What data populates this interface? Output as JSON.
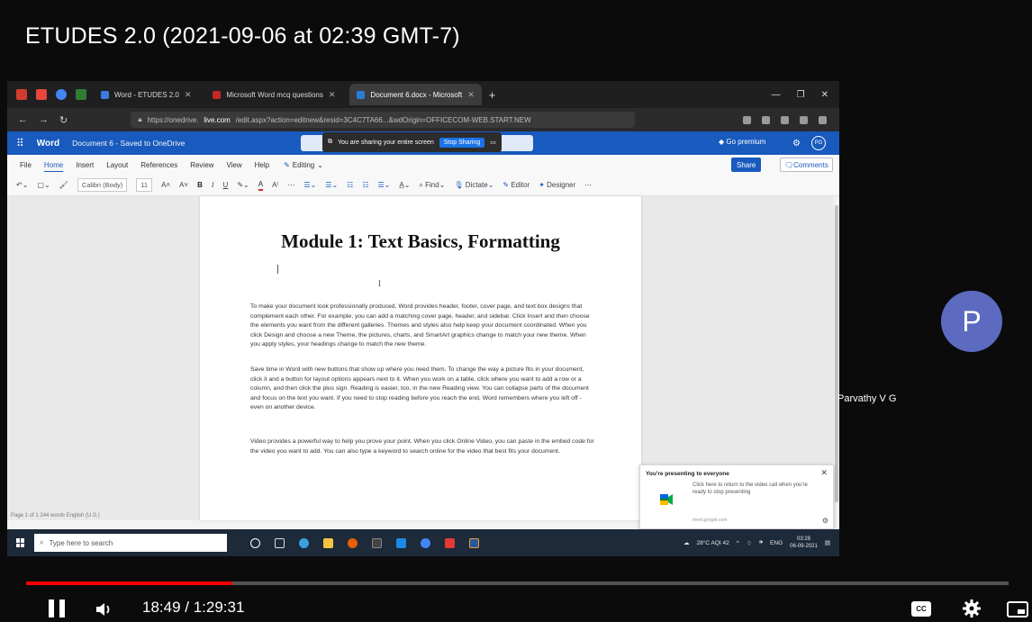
{
  "video": {
    "title": "ETUDES 2.0 (2021-09-06 at 02:39 GMT-7)",
    "current_time": "18:49",
    "duration": "1:29:31",
    "time_display": "18:49 / 1:29:31",
    "progress_fraction": 0.21
  },
  "browser": {
    "tabs": [
      {
        "label": "Word - ETUDES 2.0",
        "active": false
      },
      {
        "label": "Microsoft Word mcq questions",
        "active": false
      },
      {
        "label": "Document 6.docx - Microsoft",
        "active": true
      }
    ],
    "url_prefix": "https://onedrive.",
    "url_domain": "live.com",
    "url_rest": "/edit.aspx?action=editnew&resid=3C4C7TA66...&wdOrigin=OFFICECOM-WEB.START.NEW"
  },
  "word": {
    "app_name": "Word",
    "doc_name": "Document 6 - Saved to OneDrive",
    "share_banner": "You are sharing your entire screen",
    "stop_sharing": "Stop Sharing",
    "go_premium": "Go premium",
    "avatar_initials": "PG",
    "ribbon_tabs": [
      "File",
      "Home",
      "Insert",
      "Layout",
      "References",
      "Review",
      "View",
      "Help"
    ],
    "editing_label": "Editing",
    "share_label": "Share",
    "comments_label": "Comments",
    "font_name": "Calibri (Body)",
    "font_size": "11",
    "tools": {
      "find": "Find",
      "dictate": "Dictate",
      "editor": "Editor",
      "designer": "Designer"
    },
    "status": "Page 1 of 1    244 words    English (U.S.)"
  },
  "document": {
    "title": "Module 1: Text Basics, Formatting",
    "paragraphs": [
      "To make your document look professionally produced, Word provides header, footer, cover page, and text box designs that complement each other. For example, you can add a matching cover page, header, and sidebar. Click Insert and then choose the elements you want from the different galleries. Themes and styles also help keep your document coordinated. When you click Design and choose a new Theme, the pictures, charts, and SmartArt graphics change to match your new theme. When you apply styles, your headings change to match the new theme.",
      "Save time in Word with new buttons that show up where you need them. To change the way a picture fits in your document, click it and a button for layout options appears next to it. When you work on a table, click where you want to add a row or a column, and then click the plus sign. Reading is easier, too, in the new Reading view. You can collapse parts of the document and focus on the text you want. If you need to stop reading before you reach the end, Word remembers where you left off - even on another device.",
      "Video provides a powerful way to help you prove your point. When you click Online Video, you can paste in the embed code for the video you want to add. You can also type a keyword to search online for the video that best fits your document."
    ]
  },
  "toast": {
    "title": "You're presenting to everyone",
    "body": "Click here to return to the video call when you're ready to stop presenting",
    "footer": "meet.google.com"
  },
  "taskbar": {
    "search_placeholder": "Type here to search",
    "weather": "28°C  AQI 42",
    "lang": "ENG",
    "time": "03:28",
    "date": "06-09-2021"
  },
  "participant": {
    "initial": "P",
    "name": "Parvathy V G",
    "avatar_color": "#5c6bc0"
  },
  "colors": {
    "word_blue": "#185abd",
    "progress_red": "#ff0000"
  }
}
